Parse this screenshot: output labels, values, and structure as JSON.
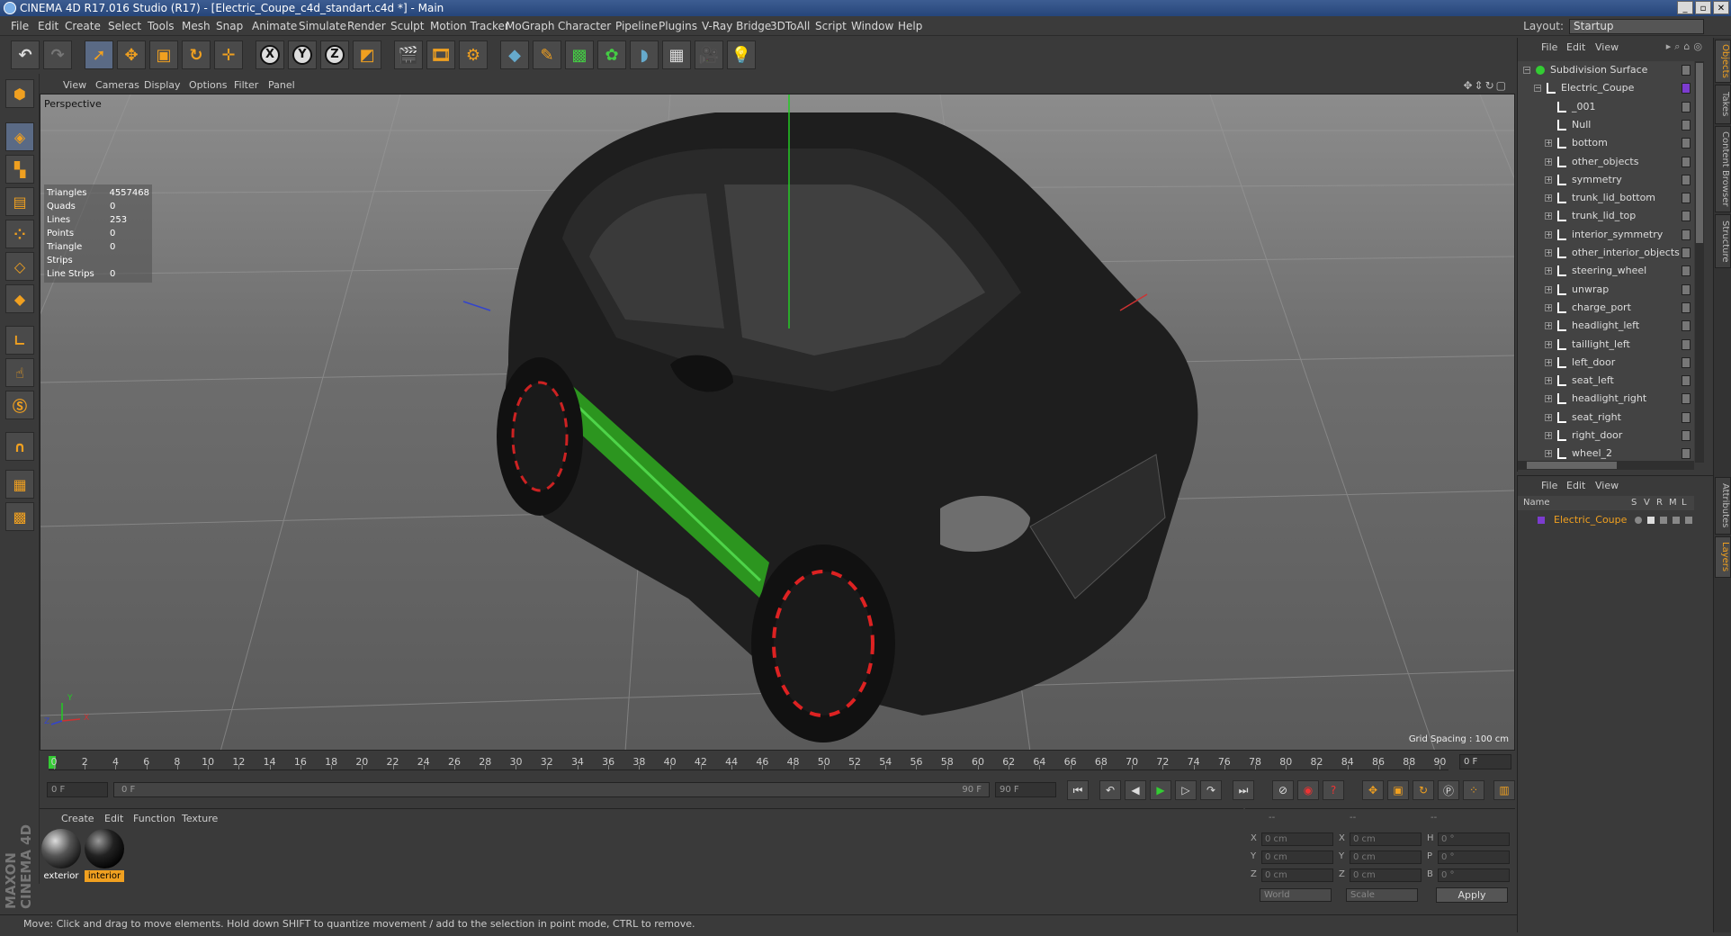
{
  "window": {
    "title": "CINEMA 4D R17.016 Studio (R17) - [Electric_Coupe_c4d_standart.c4d *] - Main"
  },
  "menu": [
    "File",
    "Edit",
    "Create",
    "Select",
    "Tools",
    "Mesh",
    "Snap",
    "Animate",
    "Simulate",
    "Render",
    "Sculpt",
    "Motion Tracker",
    "MoGraph",
    "Character",
    "Pipeline",
    "Plugins",
    "V-Ray Bridge",
    "3DToAll",
    "Script",
    "Window",
    "Help"
  ],
  "layout": {
    "label": "Layout:",
    "value": "Startup"
  },
  "viewport": {
    "menu": [
      "View",
      "Cameras",
      "Display",
      "Options",
      "Filter",
      "Panel"
    ],
    "label": "Perspective",
    "grid_spacing": "Grid Spacing : 100 cm",
    "stats": [
      {
        "k": "Triangles",
        "v": "4557468"
      },
      {
        "k": "Quads",
        "v": "0"
      },
      {
        "k": "Lines",
        "v": "253"
      },
      {
        "k": "Points",
        "v": "0"
      },
      {
        "k": "Triangle Strips",
        "v": "0"
      },
      {
        "k": "Line Strips",
        "v": "0"
      }
    ],
    "axis_labels": {
      "x": "X",
      "y": "Y",
      "z": "Z"
    }
  },
  "timeline": {
    "ticks": [
      "0",
      "2",
      "4",
      "6",
      "8",
      "10",
      "12",
      "14",
      "16",
      "18",
      "20",
      "22",
      "24",
      "26",
      "28",
      "30",
      "32",
      "34",
      "36",
      "38",
      "40",
      "42",
      "44",
      "46",
      "48",
      "50",
      "52",
      "54",
      "56",
      "58",
      "60",
      "62",
      "64",
      "66",
      "68",
      "70",
      "72",
      "74",
      "76",
      "78",
      "80",
      "82",
      "84",
      "86",
      "88",
      "90"
    ],
    "frame_end": "0 F",
    "current": "0 F",
    "slider_start": "0 F",
    "slider_end": "90 F",
    "max": "90 F"
  },
  "materials": {
    "menu": [
      "Create",
      "Edit",
      "Function",
      "Texture"
    ],
    "items": [
      {
        "label": "exterior"
      },
      {
        "label": "interior"
      }
    ]
  },
  "coords": {
    "headers": [
      "--",
      "--",
      "--"
    ],
    "rows": [
      {
        "a": "X",
        "av": "0 cm",
        "b": "X",
        "bv": "0 cm",
        "c": "H",
        "cv": "0 °"
      },
      {
        "a": "Y",
        "av": "0 cm",
        "b": "Y",
        "bv": "0 cm",
        "c": "P",
        "cv": "0 °"
      },
      {
        "a": "Z",
        "av": "0 cm",
        "b": "Z",
        "bv": "0 cm",
        "c": "B",
        "cv": "0 °"
      }
    ],
    "world": "World",
    "scale": "Scale",
    "apply": "Apply"
  },
  "status": "Move: Click and drag to move elements. Hold down SHIFT to quantize movement / add to the selection in point mode, CTRL to remove.",
  "brand": "MAXON CINEMA 4D",
  "objects": {
    "menu": [
      "File",
      "Edit",
      "View"
    ],
    "items": [
      {
        "label": "Subdivision Surface",
        "level": 0
      },
      {
        "label": "Electric_Coupe",
        "level": 1
      },
      {
        "label": "_001",
        "level": 2
      },
      {
        "label": "Null",
        "level": 2
      },
      {
        "label": "bottom",
        "level": 2
      },
      {
        "label": "other_objects",
        "level": 2
      },
      {
        "label": "symmetry",
        "level": 2
      },
      {
        "label": "trunk_lid_bottom",
        "level": 2
      },
      {
        "label": "trunk_lid_top",
        "level": 2
      },
      {
        "label": "interior_symmetry",
        "level": 2
      },
      {
        "label": "other_interior_objects",
        "level": 2
      },
      {
        "label": "steering_wheel",
        "level": 2
      },
      {
        "label": "unwrap",
        "level": 2
      },
      {
        "label": "charge_port",
        "level": 2
      },
      {
        "label": "headlight_left",
        "level": 2
      },
      {
        "label": "taillight_left",
        "level": 2
      },
      {
        "label": "left_door",
        "level": 2
      },
      {
        "label": "seat_left",
        "level": 2
      },
      {
        "label": "headlight_right",
        "level": 2
      },
      {
        "label": "seat_right",
        "level": 2
      },
      {
        "label": "right_door",
        "level": 2
      },
      {
        "label": "wheel_2",
        "level": 2
      }
    ]
  },
  "layers": {
    "menu": [
      "File",
      "Edit",
      "View"
    ],
    "columns": [
      "Name",
      "S",
      "V",
      "R",
      "M",
      "L"
    ],
    "items": [
      {
        "label": "Electric_Coupe"
      }
    ]
  },
  "right_tabs": [
    "Objects",
    "Takes",
    "Content Browser",
    "Structure",
    "Attributes",
    "Layers"
  ]
}
